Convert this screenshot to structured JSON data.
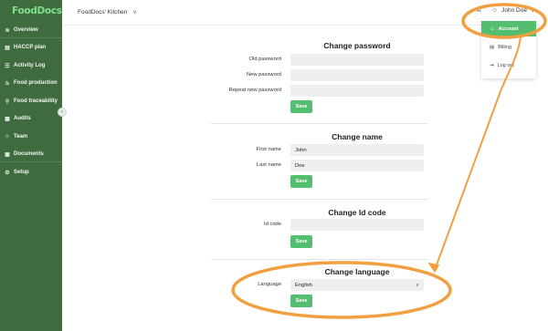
{
  "brand": {
    "logo": "FoodDocs",
    "accent": "#52be6e",
    "sidebar_bg": "#3f6b3f",
    "logo_color": "#7fe08a",
    "annotation_color": "#f0a040"
  },
  "sidebar": {
    "items": [
      {
        "label": "Overview",
        "icon": "chart-icon",
        "glyph": "≋"
      },
      {
        "label": "HACCP plan",
        "icon": "book-icon",
        "glyph": "▤"
      },
      {
        "label": "Activity Log",
        "icon": "list-icon",
        "glyph": "☰"
      },
      {
        "label": "Food production",
        "icon": "pot-icon",
        "glyph": "♨"
      },
      {
        "label": "Food traceability",
        "icon": "search-icon",
        "glyph": "⚲"
      },
      {
        "label": "Audits",
        "icon": "clipboard-icon",
        "glyph": "▦"
      },
      {
        "label": "Team",
        "icon": "person-icon",
        "glyph": "☺"
      },
      {
        "label": "Documents",
        "icon": "folder-icon",
        "glyph": "▣"
      },
      {
        "label": "Setup",
        "icon": "gear-icon",
        "glyph": "⚙"
      }
    ],
    "collapse_glyph": "‹"
  },
  "header": {
    "workspace": "FoodDocs' Kitchen",
    "user_name": "John Doe",
    "bell_glyph": "⍾",
    "chevron_glyph": "∨",
    "user_glyph": "☺"
  },
  "user_dropdown": {
    "items": [
      {
        "label": "Account",
        "icon": "person-icon",
        "glyph": "☺",
        "active": true
      },
      {
        "label": "Billing",
        "icon": "receipt-icon",
        "glyph": "▤",
        "active": false
      },
      {
        "label": "Log out",
        "icon": "logout-icon",
        "glyph": "⇥",
        "active": false
      }
    ]
  },
  "change_password": {
    "title": "Change password",
    "old_label": "Old password",
    "new_label": "New password",
    "repeat_label": "Repeat new password",
    "save_label": "Save"
  },
  "change_name": {
    "title": "Change name",
    "first_label": "First name",
    "first_value": "John",
    "last_label": "Last name",
    "last_value": "Doe",
    "save_label": "Save"
  },
  "change_id": {
    "title": "Change Id code",
    "id_label": "Id code",
    "save_label": "Save"
  },
  "change_language": {
    "title": "Change language",
    "language_label": "Language",
    "language_value": "English",
    "save_label": "Save"
  }
}
